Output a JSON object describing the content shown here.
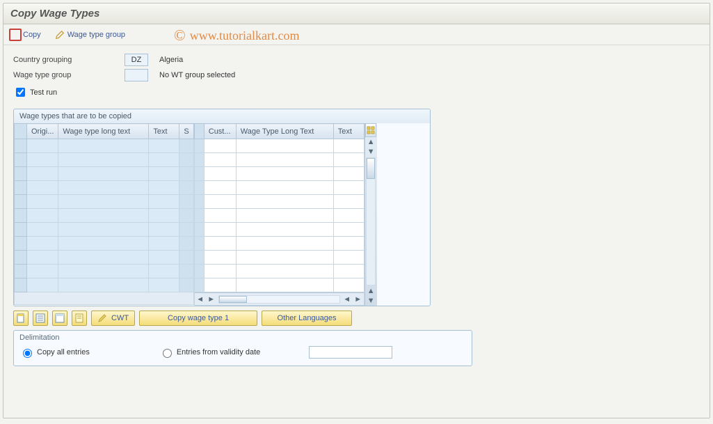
{
  "title": "Copy Wage Types",
  "toolbar": {
    "copy_label": "Copy",
    "wage_group_label": "Wage type group"
  },
  "watermark": "www.tutorialkart.com",
  "form": {
    "country_label": "Country grouping",
    "country_code": "DZ",
    "country_name": "Algeria",
    "wage_group_label": "Wage type group",
    "wage_group_code": "",
    "wage_group_text": "No WT group selected",
    "test_run_label": "Test run",
    "test_run_checked": true
  },
  "grid": {
    "panel_title": "Wage types that are to be copied",
    "left_headers": [
      "Origi...",
      "Wage type long text",
      "Text",
      "S"
    ],
    "right_headers": [
      "Cust...",
      "Wage Type Long Text",
      "Text"
    ],
    "left_rows": [
      [
        "",
        "",
        "",
        ""
      ],
      [
        "",
        "",
        "",
        ""
      ],
      [
        "",
        "",
        "",
        ""
      ],
      [
        "",
        "",
        "",
        ""
      ],
      [
        "",
        "",
        "",
        ""
      ],
      [
        "",
        "",
        "",
        ""
      ],
      [
        "",
        "",
        "",
        ""
      ],
      [
        "",
        "",
        "",
        ""
      ],
      [
        "",
        "",
        "",
        ""
      ],
      [
        "",
        "",
        "",
        ""
      ],
      [
        "",
        "",
        "",
        ""
      ]
    ],
    "right_rows": [
      [
        "",
        "",
        ""
      ],
      [
        "",
        "",
        ""
      ],
      [
        "",
        "",
        ""
      ],
      [
        "",
        "",
        ""
      ],
      [
        "",
        "",
        ""
      ],
      [
        "",
        "",
        ""
      ],
      [
        "",
        "",
        ""
      ],
      [
        "",
        "",
        ""
      ],
      [
        "",
        "",
        ""
      ],
      [
        "",
        "",
        ""
      ],
      [
        "",
        "",
        ""
      ]
    ]
  },
  "buttons": {
    "cwt_label": "CWT",
    "copy1_label": "Copy wage type 1",
    "other_lang_label": "Other Languages"
  },
  "delimitation": {
    "title": "Delimitation",
    "copy_all_label": "Copy all entries",
    "from_date_label": "Entries from validity date",
    "selected": "copy_all",
    "date_value": ""
  }
}
